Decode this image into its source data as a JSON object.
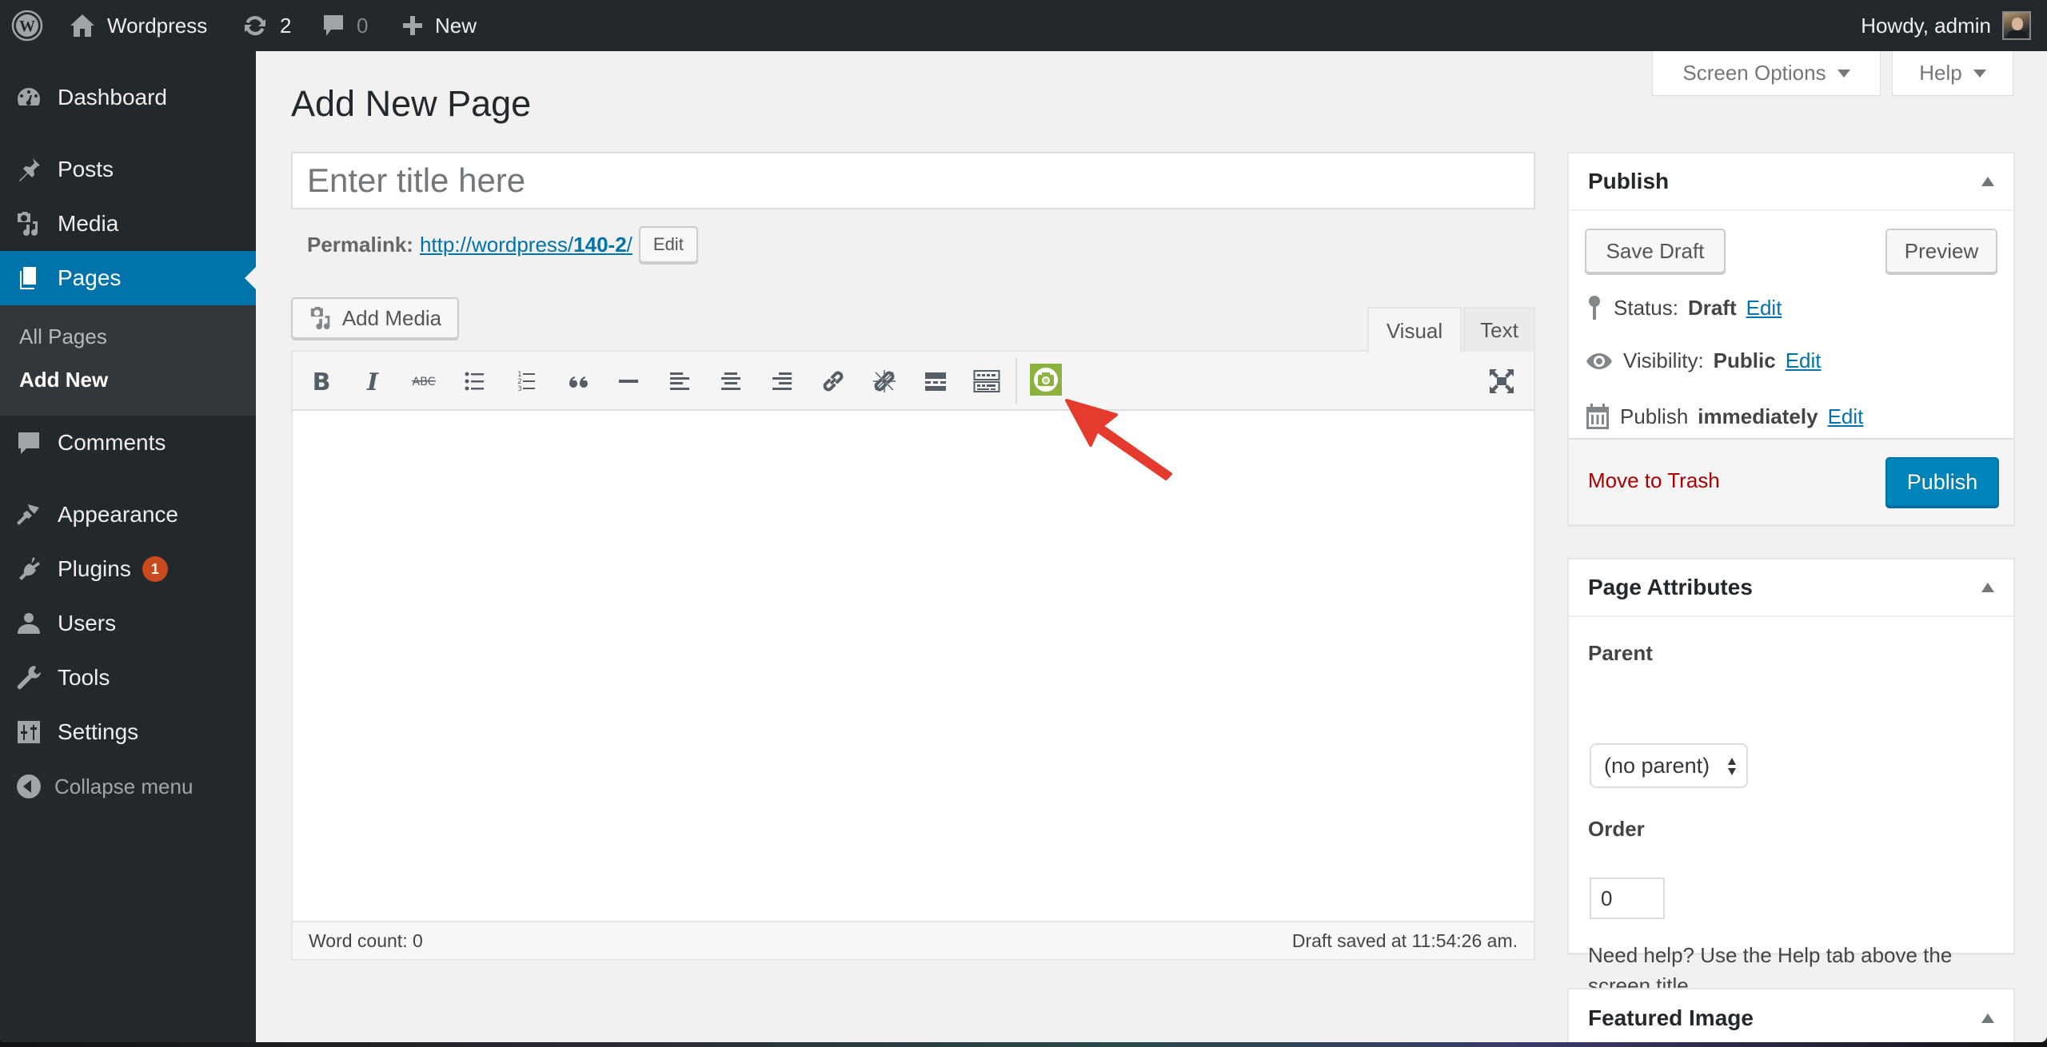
{
  "adminbar": {
    "site_name": "Wordpress",
    "updates_count": "2",
    "comments_count": "0",
    "new_label": "New",
    "greeting": "Howdy, admin"
  },
  "sidebar": {
    "items": [
      {
        "label": "Dashboard",
        "icon": "dashboard-icon"
      },
      {
        "label": "Posts",
        "icon": "pin-icon"
      },
      {
        "label": "Media",
        "icon": "media-icon"
      },
      {
        "label": "Pages",
        "icon": "pages-icon",
        "active": true
      },
      {
        "label": "Comments",
        "icon": "comment-icon"
      },
      {
        "label": "Appearance",
        "icon": "paintbrush-icon"
      },
      {
        "label": "Plugins",
        "icon": "plugin-icon",
        "badge": "1"
      },
      {
        "label": "Users",
        "icon": "user-icon"
      },
      {
        "label": "Tools",
        "icon": "wrench-icon"
      },
      {
        "label": "Settings",
        "icon": "settings-icon"
      }
    ],
    "submenu": [
      {
        "label": "All Pages"
      },
      {
        "label": "Add New",
        "current": true
      }
    ],
    "collapse_label": "Collapse menu"
  },
  "screen_meta": {
    "screen_options_label": "Screen Options",
    "help_label": "Help"
  },
  "main": {
    "page_title": "Add New Page",
    "title_placeholder": "Enter title here",
    "title_value": "",
    "permalink_label": "Permalink:",
    "permalink_base": "http://wordpress/",
    "permalink_slug": "140-2",
    "permalink_trail": "/",
    "permalink_edit_label": "Edit",
    "add_media_label": "Add Media",
    "tabs": [
      {
        "label": "Visual",
        "active": true
      },
      {
        "label": "Text",
        "active": false
      }
    ],
    "toolbar": [
      "bold-icon",
      "italic-icon",
      "strikethrough-icon",
      "bulleted-list-icon",
      "numbered-list-icon",
      "blockquote-icon",
      "horizontal-line-icon",
      "align-left-icon",
      "align-center-icon",
      "align-right-icon",
      "link-icon",
      "unlink-icon",
      "read-more-icon",
      "toolbar-toggle-icon",
      "camera-plugin-icon",
      "fullscreen-icon"
    ],
    "word_count": "Word count: 0",
    "draft_saved": "Draft saved at 11:54:26 am."
  },
  "publish_box": {
    "title": "Publish",
    "save_draft_label": "Save Draft",
    "preview_label": "Preview",
    "status_label": "Status:",
    "status_value": "Draft",
    "visibility_label": "Visibility:",
    "visibility_value": "Public",
    "schedule_label": "Publish",
    "schedule_value": "immediately",
    "edit_label": "Edit",
    "trash_label": "Move to Trash",
    "publish_label": "Publish"
  },
  "page_attributes": {
    "title": "Page Attributes",
    "parent_label": "Parent",
    "parent_value": "(no parent)",
    "order_label": "Order",
    "order_value": "0",
    "help_text": "Need help? Use the Help tab above the screen title."
  },
  "featured_image": {
    "title": "Featured Image"
  },
  "colors": {
    "admin_dark": "#23282d",
    "accent_blue": "#0073aa",
    "publish_blue": "#0085ba",
    "trash_red": "#aa0000",
    "badge_orange": "#ca4a1f",
    "plugin_green": "#8cb240",
    "annotation_red": "#e53b2f"
  }
}
